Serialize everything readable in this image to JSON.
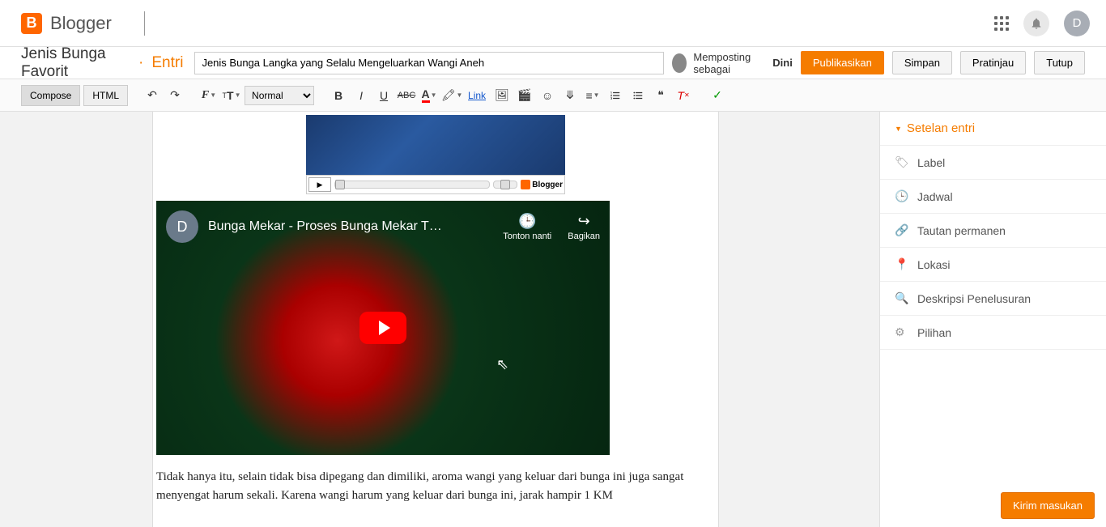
{
  "header": {
    "product": "Blogger",
    "avatar_letter": "D"
  },
  "titlebar": {
    "blog_name": "Jenis Bunga Favorit",
    "section": "Entri",
    "post_title": "Jenis Bunga Langka yang Selalu Mengeluarkan Wangi Aneh",
    "posting_as_label": "Memposting sebagai",
    "posting_user": "Dini",
    "publish": "Publikasikan",
    "save": "Simpan",
    "preview": "Pratinjau",
    "close": "Tutup"
  },
  "toolbar": {
    "compose": "Compose",
    "html": "HTML",
    "format_select": "Normal",
    "link": "Link"
  },
  "editor": {
    "blogger_widget_label": "Blogger",
    "video_avatar_letter": "D",
    "video_title": "Bunga Mekar - Proses Bunga Mekar T…",
    "watch_later": "Tonton nanti",
    "share": "Bagikan",
    "paragraph": "Tidak hanya itu, selain tidak bisa dipegang dan dimiliki, aroma wangi yang keluar dari bunga ini juga sangat menyengat harum sekali. Karena wangi harum yang keluar dari bunga ini, jarak hampir 1 KM"
  },
  "sidebar": {
    "header": "Setelan entri",
    "items": [
      {
        "icon": "🏷",
        "label": "Label"
      },
      {
        "icon": "🕒",
        "label": "Jadwal"
      },
      {
        "icon": "🔗",
        "label": "Tautan permanen"
      },
      {
        "icon": "📍",
        "label": "Lokasi"
      },
      {
        "icon": "🔍",
        "label": "Deskripsi Penelusuran"
      },
      {
        "icon": "⚙",
        "label": "Pilihan"
      }
    ]
  },
  "feedback": "Kirim masukan"
}
